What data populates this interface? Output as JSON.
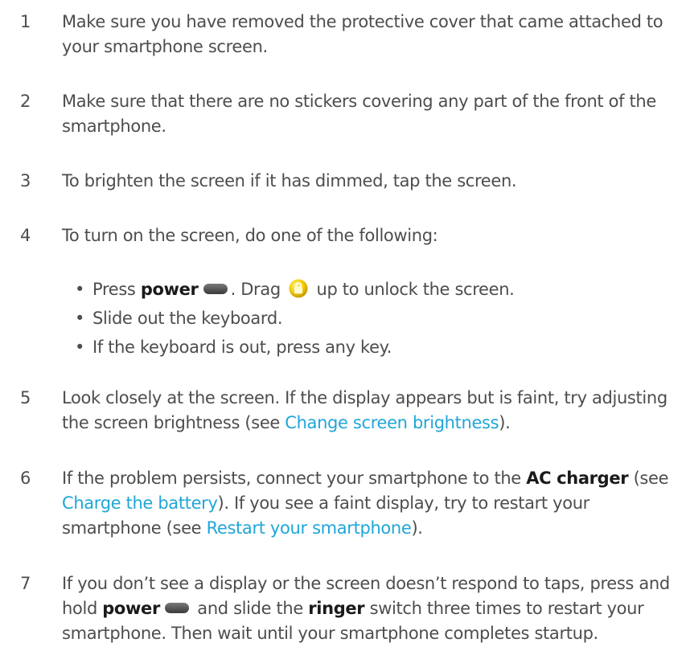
{
  "steps": [
    {
      "num": "1",
      "text": "Make sure you have removed the protective cover that came attached to your smartphone screen."
    },
    {
      "num": "2",
      "text": "Make sure that there are no stickers covering any part of the front of the smartphone."
    },
    {
      "num": "3",
      "text": "To brighten the screen if it has dimmed, tap the screen."
    },
    {
      "num": "4",
      "text": "To turn on the screen, do one of the following:"
    },
    {
      "num": "5",
      "text_before": "Look closely at the screen. If the display appears but is faint, try adjusting the screen brightness (see ",
      "link": "Change screen brightness",
      "text_after": ")."
    },
    {
      "num": "6",
      "text_before": "If the problem persists, connect your smartphone to the ",
      "bold": "AC charger",
      "text_mid1": " (see ",
      "link1": "Charge the battery",
      "text_mid2": "). If you see a faint display, try to restart your smartphone (see ",
      "link2": "Restart your smartphone",
      "text_after": ")."
    },
    {
      "num": "7",
      "text_before": "If you don’t see a display or the screen doesn’t respond to taps, press and hold ",
      "bold1": "power",
      "text_mid": " and slide the ",
      "bold2": "ringer",
      "text_after": " switch three times to restart your smartphone. Then wait until your smartphone completes startup."
    }
  ],
  "bullets": {
    "dot": "•",
    "item1": {
      "prefix": "Press ",
      "bold": "power",
      "mid": ". Drag ",
      "suffix": " up to unlock the screen."
    },
    "item2": "Slide out the keyboard.",
    "item3": "If the keyboard is out, press any key."
  },
  "icons": {
    "power_button": "power-button-icon",
    "unlock_lock": "lock-icon"
  },
  "colors": {
    "text": "#4d4d4d",
    "bold": "#1a1a1a",
    "link": "#1fa6d8",
    "lock_icon": "#f2c200"
  }
}
